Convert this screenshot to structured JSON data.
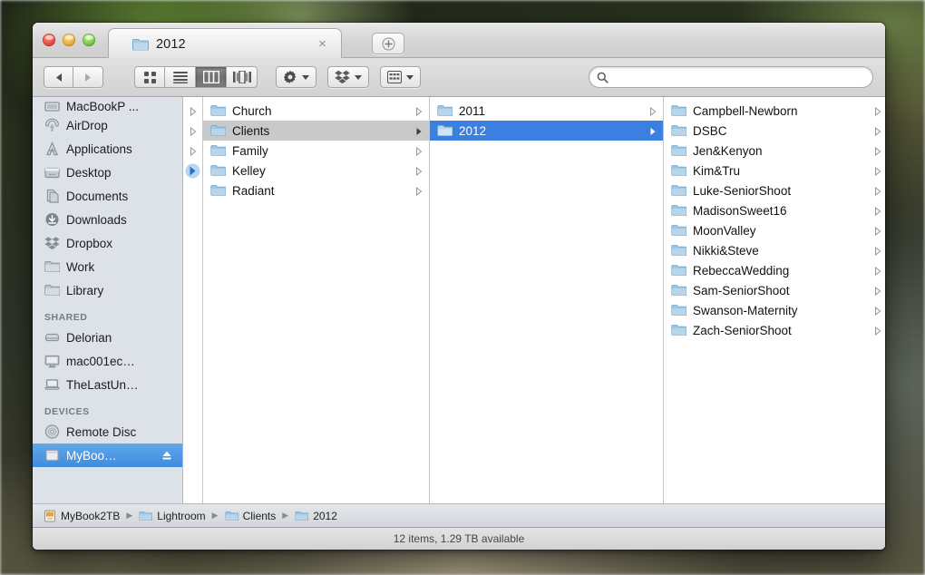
{
  "window": {
    "title": "2012",
    "traffic_lights": [
      "close",
      "minimize",
      "zoom"
    ],
    "tab_close_glyph": "×",
    "new_tab_label": "+"
  },
  "toolbar": {
    "back_label": "◀",
    "forward_label": "▶",
    "view_modes": [
      {
        "name": "icon-view",
        "active": false
      },
      {
        "name": "list-view",
        "active": false
      },
      {
        "name": "column-view",
        "active": true
      },
      {
        "name": "coverflow-view",
        "active": false
      }
    ],
    "action_menu": "gear-icon",
    "dropbox_menu": "dropbox-icon",
    "arrange_menu": "arrange-icon",
    "dropdown_glyph": "▼"
  },
  "search": {
    "value": "",
    "placeholder": ""
  },
  "sidebar": {
    "favorites": [
      {
        "label": "MacBookP ...",
        "icon": "computer-icon",
        "clipped": true,
        "selected": false
      },
      {
        "label": "AirDrop",
        "icon": "airdrop-icon",
        "selected": false
      },
      {
        "label": "Applications",
        "icon": "applications-icon",
        "selected": false
      },
      {
        "label": "Desktop",
        "icon": "desktop-icon",
        "selected": false
      },
      {
        "label": "Documents",
        "icon": "documents-icon",
        "selected": false
      },
      {
        "label": "Downloads",
        "icon": "downloads-icon",
        "selected": false
      },
      {
        "label": "Dropbox",
        "icon": "dropbox-icon",
        "selected": false
      },
      {
        "label": "Work",
        "icon": "folder-icon",
        "selected": false
      },
      {
        "label": "Library",
        "icon": "folder-icon",
        "selected": false
      }
    ],
    "shared_header": "SHARED",
    "shared": [
      {
        "label": "Delorian",
        "icon": "server-icon",
        "selected": false
      },
      {
        "label": "mac001ec…",
        "icon": "imac-icon",
        "selected": false
      },
      {
        "label": "TheLastUn…",
        "icon": "laptop-icon",
        "selected": false
      }
    ],
    "devices_header": "DEVICES",
    "devices": [
      {
        "label": "Remote Disc",
        "icon": "disc-icon",
        "selected": false
      },
      {
        "label": "MyBoo…",
        "icon": "drive-icon",
        "selected": true,
        "eject": true
      }
    ]
  },
  "columns": [
    {
      "name": "column-stub",
      "items": [
        {
          "label": "",
          "chevron": "gray"
        },
        {
          "label": "",
          "chevron": "gray"
        },
        {
          "label": "",
          "chevron": "gray"
        },
        {
          "label": "",
          "chevron": "blue-selected"
        },
        {
          "label": "",
          "chevron": "none"
        }
      ]
    },
    {
      "name": "column-lightroom",
      "items": [
        {
          "label": "Church",
          "chevron": "gray",
          "state": "none"
        },
        {
          "label": "Clients",
          "chevron": "dark",
          "state": "gray-selected"
        },
        {
          "label": "Family",
          "chevron": "gray",
          "state": "none"
        },
        {
          "label": "Kelley",
          "chevron": "gray",
          "state": "none"
        },
        {
          "label": "Radiant",
          "chevron": "gray",
          "state": "none"
        }
      ]
    },
    {
      "name": "column-clients",
      "items": [
        {
          "label": "2011",
          "chevron": "gray",
          "state": "none"
        },
        {
          "label": "2012",
          "chevron": "white",
          "state": "blue-selected"
        }
      ]
    },
    {
      "name": "column-2012",
      "items": [
        {
          "label": "Campbell-Newborn",
          "chevron": "gray",
          "state": "none"
        },
        {
          "label": "DSBC",
          "chevron": "gray",
          "state": "none"
        },
        {
          "label": "Jen&Kenyon",
          "chevron": "gray",
          "state": "none"
        },
        {
          "label": "Kim&Tru",
          "chevron": "gray",
          "state": "none"
        },
        {
          "label": "Luke-SeniorShoot",
          "chevron": "gray",
          "state": "none"
        },
        {
          "label": "MadisonSweet16",
          "chevron": "gray",
          "state": "none"
        },
        {
          "label": "MoonValley",
          "chevron": "gray",
          "state": "none"
        },
        {
          "label": "Nikki&Steve",
          "chevron": "gray",
          "state": "none"
        },
        {
          "label": "RebeccaWedding",
          "chevron": "gray",
          "state": "none"
        },
        {
          "label": "Sam-SeniorShoot",
          "chevron": "gray",
          "state": "none"
        },
        {
          "label": "Swanson-Maternity",
          "chevron": "gray",
          "state": "none"
        },
        {
          "label": "Zach-SeniorShoot",
          "chevron": "gray",
          "state": "none"
        }
      ]
    },
    {
      "name": "column-preview-empty",
      "items": []
    }
  ],
  "path_bar": {
    "crumbs": [
      {
        "label": "MyBook2TB",
        "icon": "drive-icon"
      },
      {
        "label": "Lightroom",
        "icon": "folder-icon"
      },
      {
        "label": "Clients",
        "icon": "folder-icon"
      },
      {
        "label": "2012",
        "icon": "folder-icon"
      }
    ],
    "separator": "▶"
  },
  "status_bar": {
    "text": "12 items, 1.29 TB available"
  },
  "colors": {
    "selection_blue": "#3b7fe0",
    "sidebar_selection_blue": "#3f8cde",
    "row_selection_gray": "#c9c9c9",
    "sidebar_bg": "#dde2e9",
    "folder_blue": "#9ec7e4",
    "drive_orange": "#e8a33d"
  }
}
